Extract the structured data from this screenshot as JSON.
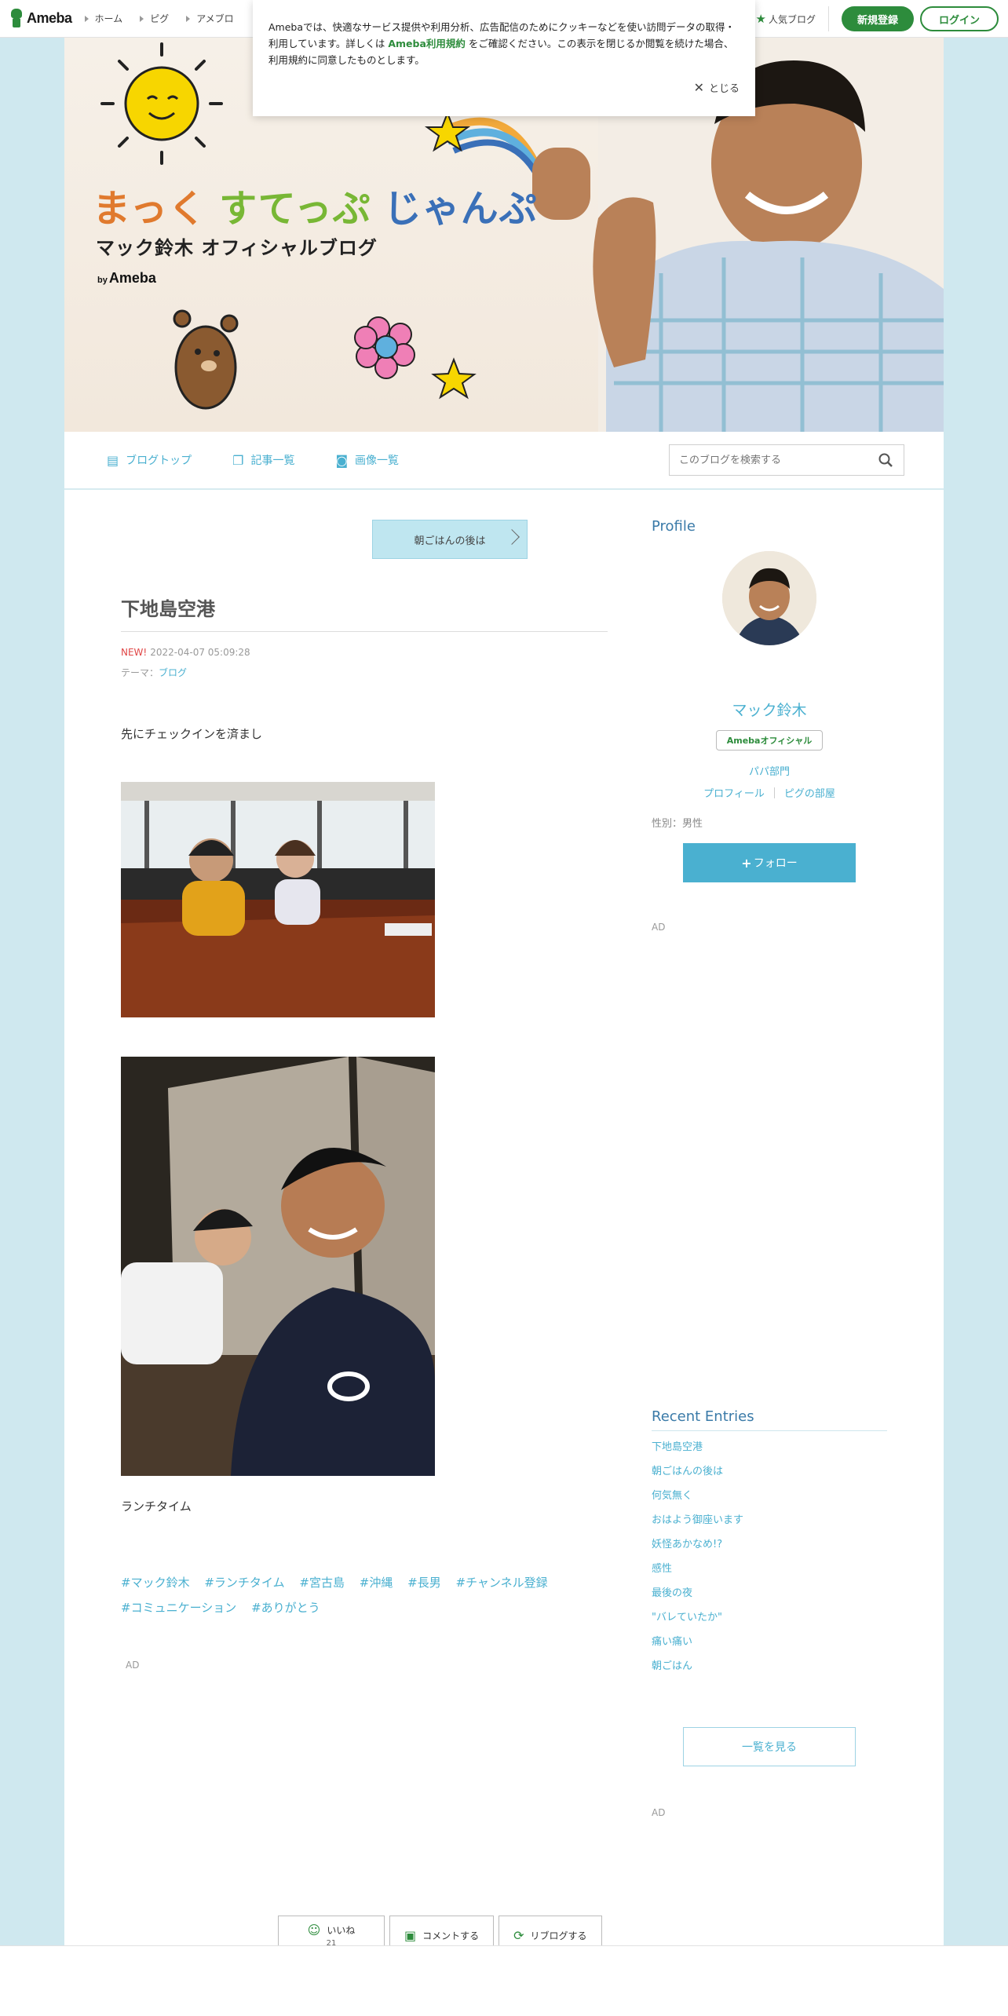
{
  "topbar": {
    "logo": "Ameba",
    "nav": [
      "ホーム",
      "ピグ",
      "アメブロ"
    ],
    "popular": "人気ブログ",
    "register": "新規登録",
    "login": "ログイン"
  },
  "cookie": {
    "text_before": "Amebaでは、快適なサービス提供や利用分析、広告配信のためにクッキーなどを使い訪問データの取得・利用しています。詳しくは ",
    "link": "Ameba利用規約",
    "text_after": " をご確認ください。この表示を閉じるか閲覧を続けた場合、利用規約に同意したものとします。",
    "close": "とじる"
  },
  "banner": {
    "title_1": "まっく",
    "title_2": "すてっぷ",
    "title_3": "じゃんぷ",
    "subtitle": "マック鈴木 オフィシャルブログ",
    "by": "by",
    "by_brand": "Ameba"
  },
  "blognav": {
    "items": [
      "ブログトップ",
      "記事一覧",
      "画像一覧"
    ],
    "search_placeholder": "このブログを検索する"
  },
  "article": {
    "prev_label": "朝ごはんの後は",
    "title": "下地島空港",
    "new_label": "NEW!",
    "date": "2022-04-07 05:09:28",
    "theme_label": "テーマ：",
    "theme": "ブログ",
    "text1": "先にチェックインを済まし",
    "text2": "ランチタイム",
    "hashtags": [
      "#マック鈴木",
      "#ランチタイム",
      "#宮古島",
      "#沖縄",
      "#長男",
      "#チャンネル登録",
      "#コミュニケーション",
      "#ありがとう"
    ],
    "ad": "AD",
    "like_label": "いいね",
    "like_count": "21",
    "comment_label": "コメントする",
    "reblog_label": "リブログする"
  },
  "sidebar": {
    "profile_heading": "Profile",
    "name": "マック鈴木",
    "badge": "Amebaオフィシャル",
    "category": "パパ部門",
    "links": [
      "プロフィール",
      "ピグの部屋"
    ],
    "gender": "性別：男性",
    "follow_label": "フォロー",
    "ad": "AD",
    "recent_heading": "Recent Entries",
    "entries": [
      "下地島空港",
      "朝ごはんの後は",
      "何気無く",
      "おはよう御座います",
      "妖怪あかなめ!?",
      "感性",
      "最後の夜",
      "\"バレていたか\"",
      "痛い痛い",
      "朝ごはん"
    ],
    "more_label": "一覧を見る"
  }
}
